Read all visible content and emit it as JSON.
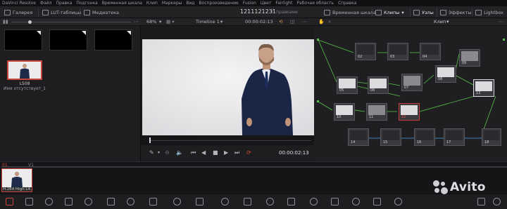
{
  "menu": {
    "items": [
      "DaVinci Resolve",
      "Файл",
      "Правка",
      "Подгонка",
      "Временная шкала",
      "Клип",
      "Маркеры",
      "Вид",
      "Воспроизведение",
      "Fusion",
      "Цвет",
      "Fairlight",
      "Рабочая область",
      "Справка"
    ]
  },
  "toolbar": {
    "gallery": "Галерея",
    "luts": "LUT-таблицы",
    "mediapool": "Медиатека",
    "project_title": "1211121231",
    "saved": "С правками",
    "timeline": "Временная шкала",
    "clips": "Клипы",
    "nodes": "Узлы",
    "effects": "Эффекты",
    "lightbox": "Lightbox"
  },
  "mediapool": {
    "clip_name": "LS08",
    "clip_sub": "Имя отсутствует_1"
  },
  "viewer": {
    "zoom": "68%",
    "timeline_name": "Timeline 1",
    "timecode_top": "00:00:02:13",
    "timecode": "00:00:02:13"
  },
  "nodes": {
    "mode": "Клип",
    "labels": [
      "02",
      "03",
      "04",
      "05",
      "06",
      "07",
      "08",
      "09",
      "10",
      "11",
      "12",
      "13",
      "14",
      "15",
      "16",
      "17",
      "18"
    ]
  },
  "timeline": {
    "clip_index": "01",
    "track": "V1",
    "clip_label": "H.264 High L4..."
  },
  "watermark": {
    "text": "Avito"
  },
  "colors": {
    "accent_red": "#c8463e",
    "port_green": "#59c24a",
    "port_blue": "#4aa0e0",
    "loop_orange": "#d9532f"
  }
}
